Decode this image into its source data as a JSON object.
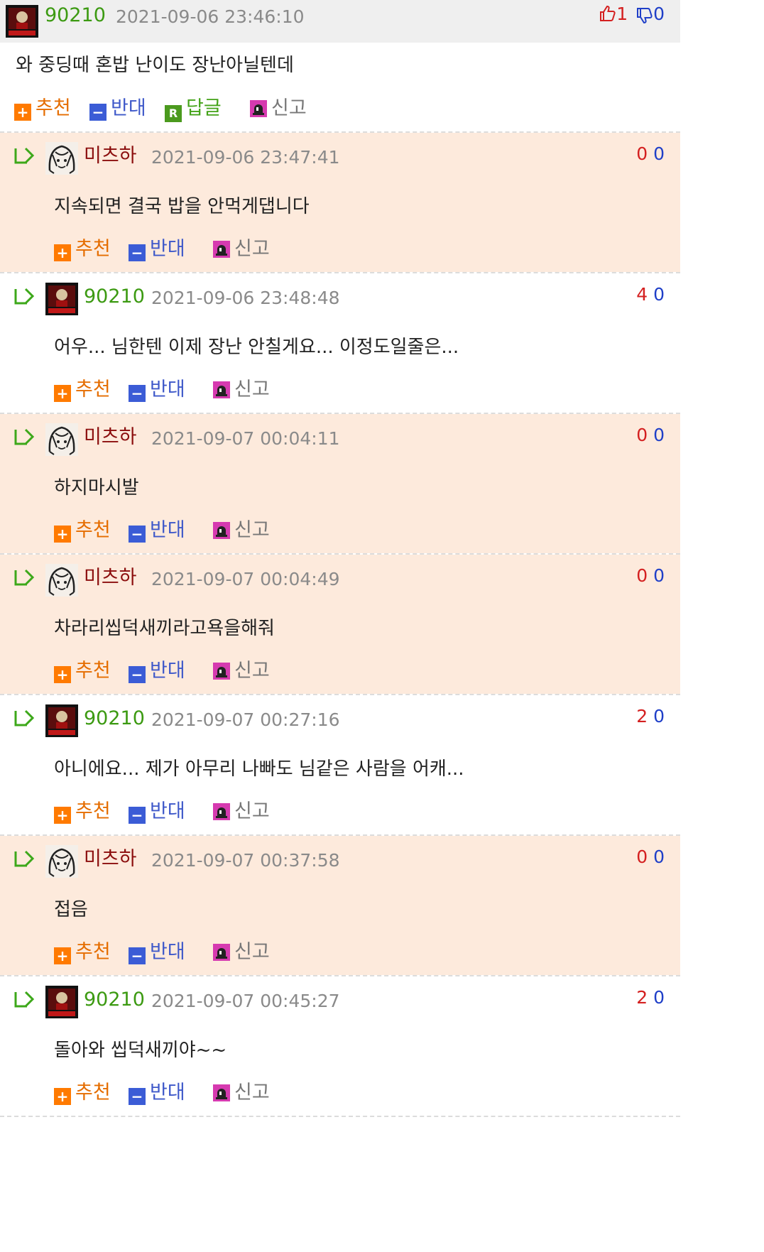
{
  "top": {
    "nick": "90210",
    "date": "2021-09-06 23:46:10",
    "up": "1",
    "down": "0",
    "text": "와 중딩때 혼밥 난이도 장난아닐텐데",
    "actions": {
      "recommend": "추천",
      "oppose": "반대",
      "reply": "답글",
      "report": "신고"
    },
    "reply_icon_letter": "R"
  },
  "replies": [
    {
      "nick": "미츠하",
      "date": "2021-09-06 23:47:41",
      "up": "0",
      "down": "0",
      "text": "지속되면 결국 밥을 안먹게댑니다",
      "recommend": "추천",
      "oppose": "반대",
      "report": "신고"
    },
    {
      "nick": "90210",
      "date": "2021-09-06 23:48:48",
      "up": "4",
      "down": "0",
      "text": "어우... 님한텐 이제 장난 안칠게요... 이정도일줄은...",
      "recommend": "추천",
      "oppose": "반대",
      "report": "신고"
    },
    {
      "nick": "미츠하",
      "date": "2021-09-07 00:04:11",
      "up": "0",
      "down": "0",
      "text": "하지마시발",
      "recommend": "추천",
      "oppose": "반대",
      "report": "신고"
    },
    {
      "nick": "미츠하",
      "date": "2021-09-07 00:04:49",
      "up": "0",
      "down": "0",
      "text": "차라리씹덕새끼라고욕을해줘",
      "recommend": "추천",
      "oppose": "반대",
      "report": "신고"
    },
    {
      "nick": "90210",
      "date": "2021-09-07 00:27:16",
      "up": "2",
      "down": "0",
      "text": "아니에요... 제가 아무리 나빠도 님같은 사람을 어캐...",
      "recommend": "추천",
      "oppose": "반대",
      "report": "신고"
    },
    {
      "nick": "미츠하",
      "date": "2021-09-07 00:37:58",
      "up": "0",
      "down": "0",
      "text": "접음",
      "recommend": "추천",
      "oppose": "반대",
      "report": "신고"
    },
    {
      "nick": "90210",
      "date": "2021-09-07 00:45:27",
      "up": "2",
      "down": "0",
      "text": "돌아와 씹덕새끼야~~",
      "recommend": "추천",
      "oppose": "반대",
      "report": "신고"
    }
  ],
  "icons": {
    "thumbs_up": "thumbs-up-icon",
    "thumbs_down": "thumbs-down-icon",
    "reply_arrow": "reply-arrow-icon",
    "plus": "plus-icon",
    "minus": "minus-icon",
    "alarm": "alarm-icon"
  },
  "colors": {
    "green_nick": "#3c9a12",
    "red_nick": "#8b0d0d",
    "peach_bg": "#fdeadc",
    "up_vote": "#d42020",
    "down_vote": "#1f3fc8"
  }
}
